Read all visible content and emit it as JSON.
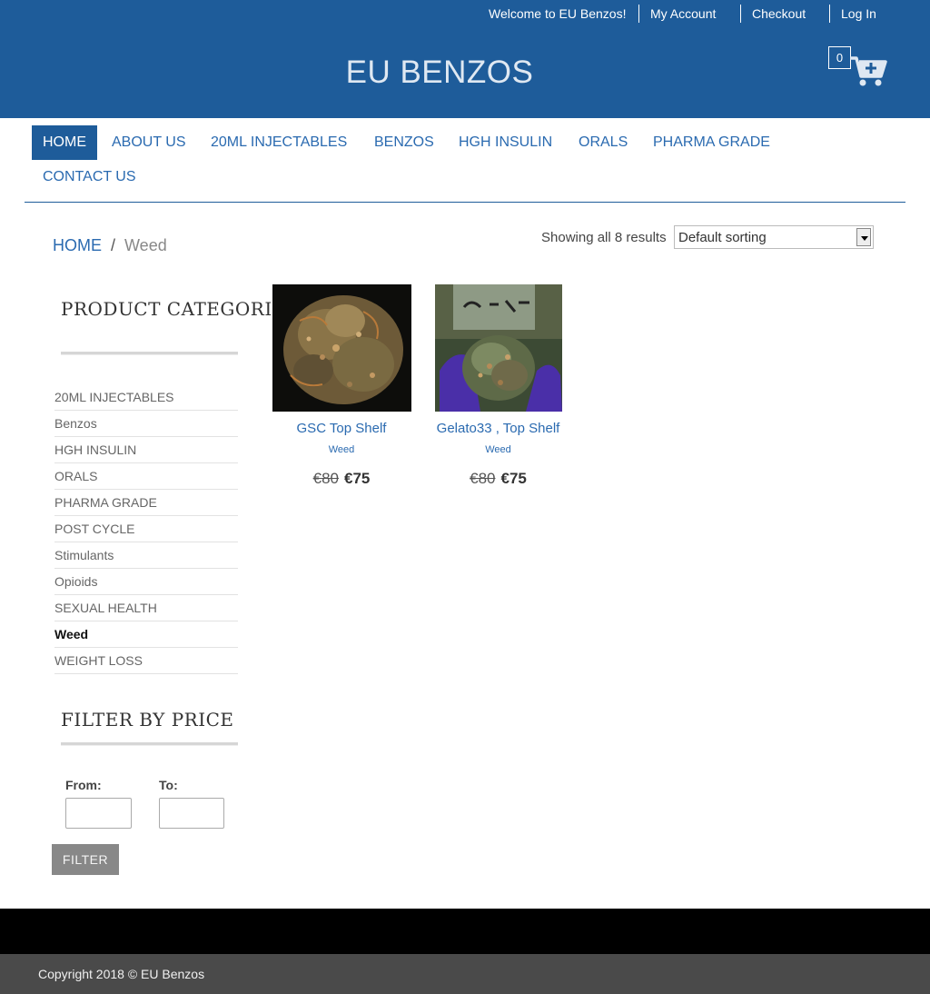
{
  "topbar": {
    "welcome": "Welcome to EU Benzos!",
    "my_account": "My Account",
    "checkout": "Checkout",
    "login": "Log In"
  },
  "header": {
    "logo": "EU BENZOS",
    "cart_count": "0",
    "cart_icon": "cart-plus-icon"
  },
  "nav": {
    "items": [
      "HOME",
      "ABOUT US",
      "20ML INJECTABLES",
      "BENZOS",
      "HGH INSULIN",
      "ORALS",
      "PHARMA GRADE",
      "CONTACT US"
    ],
    "active": "HOME"
  },
  "breadcrumb": {
    "home": "HOME",
    "separator": "/",
    "current": "Weed"
  },
  "shop": {
    "result_count": "Showing all 8 results",
    "sort_selected": "Default sorting"
  },
  "sidebar": {
    "categories_title": "PRODUCT CATEGORIES",
    "categories": [
      "20ML INJECTABLES",
      "Benzos",
      "HGH INSULIN",
      "ORALS",
      "PHARMA GRADE",
      "POST CYCLE",
      "Stimulants",
      "Opioids",
      "SEXUAL HEALTH",
      "Weed",
      "WEIGHT LOSS"
    ],
    "active_category": "Weed",
    "filter_title": "FILTER BY PRICE",
    "from_label": "From:",
    "to_label": "To:",
    "from_value": "",
    "to_value": "",
    "filter_button": "FILTER"
  },
  "products": [
    {
      "name": "GSC Top Shelf",
      "category": "Weed",
      "old_price": "€80",
      "price": "€75"
    },
    {
      "name": "Gelato33 , Top Shelf",
      "category": "Weed",
      "old_price": "€80",
      "price": "€75"
    }
  ],
  "footer": {
    "copyright": "Copyright 2018 © EU Benzos"
  },
  "colors": {
    "brand_blue": "#1e5c9a",
    "link_blue": "#2a6ab0",
    "footer_black": "#000000",
    "footer_gray": "#4a4a4a"
  }
}
